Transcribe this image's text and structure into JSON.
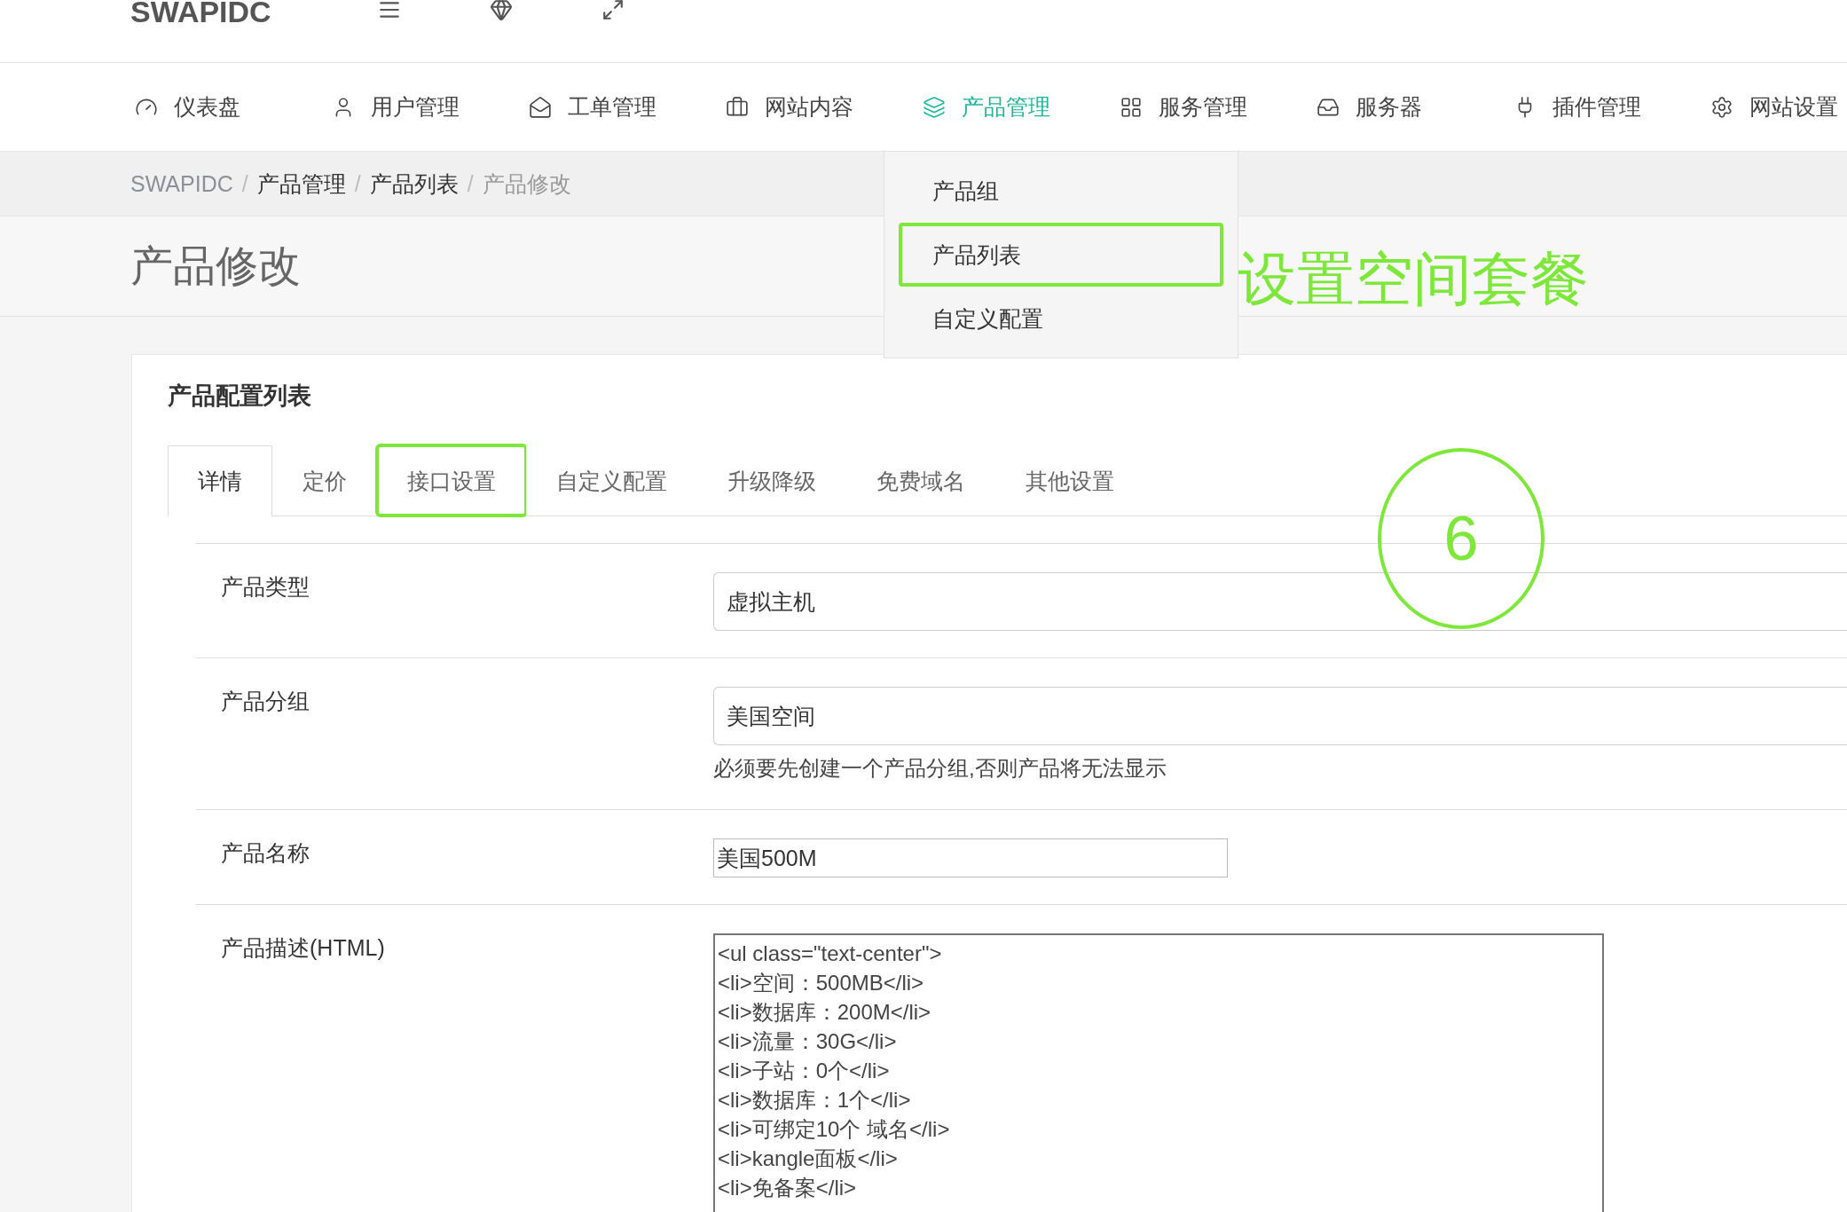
{
  "header": {
    "logo": "SWAPIDC"
  },
  "nav": [
    {
      "label": "仪表盘",
      "selected": false
    },
    {
      "label": "用户管理",
      "selected": false
    },
    {
      "label": "工单管理",
      "selected": false
    },
    {
      "label": "网站内容",
      "selected": false
    },
    {
      "label": "产品管理",
      "selected": true,
      "menu": [
        {
          "label": "产品组",
          "annotated": false
        },
        {
          "label": "产品列表",
          "annotated": true
        },
        {
          "label": "自定义配置",
          "annotated": false
        }
      ]
    },
    {
      "label": "服务管理",
      "selected": false
    },
    {
      "label": "服务器",
      "selected": false
    },
    {
      "label": "插件管理",
      "selected": false
    },
    {
      "label": "网站设置",
      "selected": false
    }
  ],
  "breadcrumb": {
    "separator": "/",
    "items": [
      {
        "label": "SWAPIDC",
        "kind": "home"
      },
      {
        "label": "产品管理",
        "kind": "link"
      },
      {
        "label": "产品列表",
        "kind": "link"
      },
      {
        "label": "产品修改",
        "kind": "current"
      }
    ]
  },
  "page_title": "产品修改",
  "card": {
    "title": "产品配置列表",
    "tabs": [
      {
        "label": "详情",
        "selected": true,
        "annotated": false
      },
      {
        "label": "定价",
        "selected": false,
        "annotated": false
      },
      {
        "label": "接口设置",
        "selected": false,
        "annotated": true
      },
      {
        "label": "自定义配置",
        "selected": false,
        "annotated": false
      },
      {
        "label": "升级降级",
        "selected": false,
        "annotated": false
      },
      {
        "label": "免费域名",
        "selected": false,
        "annotated": false
      },
      {
        "label": "其他设置",
        "selected": false,
        "annotated": false
      }
    ],
    "fields": [
      {
        "kind": "select",
        "label": "产品类型",
        "value": "虚拟主机"
      },
      {
        "kind": "select",
        "label": "产品分组",
        "value": "美国空间",
        "help": "必须要先创建一个产品分组,否则产品将无法显示"
      },
      {
        "kind": "input",
        "label": "产品名称",
        "value": "美国500M"
      },
      {
        "kind": "textarea",
        "label": "产品描述(HTML)",
        "lines": [
          "<ul class=\"text-center\">",
          "<li>空间：500MB</li>",
          "<li>数据库：200M</li>",
          "<li>流量：30G</li>",
          "<li>子站：0个</li>",
          "<li>数据库：1个</li>",
          "<li>可绑定10个 域名</li>",
          "<li>kangle面板</li>",
          "<li>免备案</li>"
        ]
      }
    ]
  },
  "annotations": {
    "note": "设置空间套餐",
    "step": "6"
  }
}
